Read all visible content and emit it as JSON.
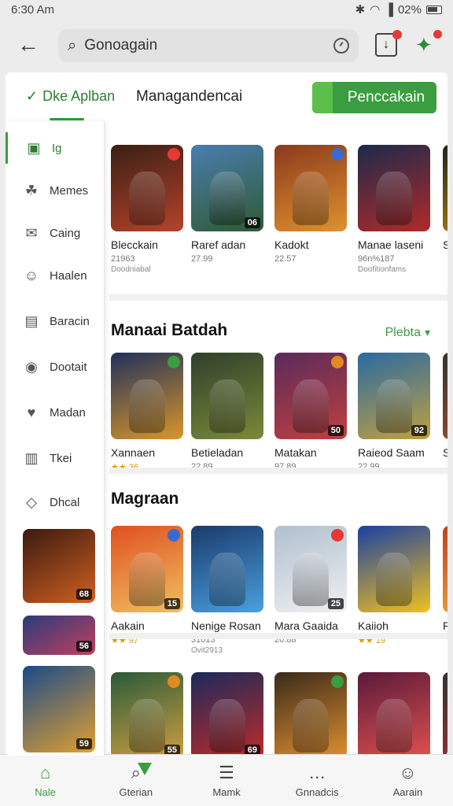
{
  "status": {
    "time": "6:30 Am",
    "battery": "02%"
  },
  "search": {
    "query": "Gonoagain"
  },
  "tabs": {
    "first": "Dke Aplban",
    "second": "Managandencai",
    "cta": "Penccakain"
  },
  "rail": [
    {
      "label": "Ig",
      "icon": "grid-icon",
      "active": true
    },
    {
      "label": "Memes",
      "icon": "leaf-icon"
    },
    {
      "label": "Caing",
      "icon": "mail-icon"
    },
    {
      "label": "Haalen",
      "icon": "person-icon"
    },
    {
      "label": "Baracin",
      "icon": "bag-icon"
    },
    {
      "label": "Dootait",
      "icon": "controller-icon"
    },
    {
      "label": "Madan",
      "icon": "heart-icon"
    },
    {
      "label": "Tkei",
      "icon": "book-icon"
    },
    {
      "label": "Dhcal",
      "icon": "tag-icon"
    }
  ],
  "rail_thumbs": [
    {
      "rating": "68"
    },
    {
      "rating": "56"
    },
    {
      "rating": "59"
    }
  ],
  "sections": [
    {
      "title": "",
      "link": "",
      "cards": [
        {
          "name": "Blecckain",
          "meta": "21963",
          "meta2": "Doodniabal",
          "rating": "",
          "colors": [
            "#3a1f14",
            "#b5432a"
          ]
        },
        {
          "name": "Raref adan",
          "meta": "27.99",
          "meta2": "",
          "rating": "06",
          "colors": [
            "#4a7db0",
            "#2f5a32"
          ]
        },
        {
          "name": "Kadokt",
          "meta": "22.57",
          "meta2": "",
          "rating": "",
          "colors": [
            "#8a3a1c",
            "#e0912f"
          ]
        },
        {
          "name": "Manae laseni",
          "meta": "96n%187",
          "meta2": "Doofitionfams",
          "rating": "",
          "colors": [
            "#1b2a4a",
            "#b02a2a"
          ]
        },
        {
          "name": "Sc",
          "meta": "",
          "meta2": "",
          "rating": "",
          "colors": [
            "#222",
            "#b8860b"
          ]
        }
      ]
    },
    {
      "title": "Manaai  Batdah",
      "link": "Plebta",
      "cards": [
        {
          "name": "Xannaen",
          "meta": "★★ 36",
          "meta2": "",
          "rating": "",
          "colors": [
            "#20305a",
            "#d9962a"
          ]
        },
        {
          "name": "Betieladan",
          "meta": "22.89",
          "meta2": "",
          "rating": "",
          "colors": [
            "#2f3f2a",
            "#7a8a3a"
          ]
        },
        {
          "name": "Matakan",
          "meta": "97.89",
          "meta2": "",
          "rating": "50",
          "colors": [
            "#5a2a5a",
            "#c04040"
          ]
        },
        {
          "name": "Raieod Saam",
          "meta": "22.99",
          "meta2": "",
          "rating": "92",
          "colors": [
            "#2a6aa0",
            "#c0a040"
          ]
        },
        {
          "name": "Sc",
          "meta": "",
          "meta2": "",
          "rating": "",
          "colors": [
            "#333",
            "#a0502a"
          ]
        }
      ]
    },
    {
      "title": "Magraan",
      "link": "",
      "cards": [
        {
          "name": "Aakain",
          "meta": "★★ 97",
          "meta2": "",
          "rating": "15",
          "colors": [
            "#e05020",
            "#f0c060"
          ]
        },
        {
          "name": "Nenige Rosan",
          "meta": "31013",
          "meta2": "Ovit2913",
          "rating": "",
          "colors": [
            "#1a3a6a",
            "#4aa0e0"
          ]
        },
        {
          "name": "Mara Gaaida",
          "meta": "20.88",
          "meta2": "",
          "rating": "25",
          "colors": [
            "#b0c0d0",
            "#f0f0f0"
          ]
        },
        {
          "name": "Kaiioh",
          "meta": "★★ 19",
          "meta2": "",
          "rating": "",
          "colors": [
            "#1a40a0",
            "#f0c020"
          ]
        },
        {
          "name": "Ra",
          "meta": "",
          "meta2": "",
          "rating": "",
          "colors": [
            "#c04020",
            "#f0b040"
          ]
        }
      ]
    },
    {
      "title": "",
      "link": "",
      "cards": [
        {
          "name": "",
          "meta": "",
          "meta2": "",
          "rating": "55",
          "colors": [
            "#2a5a3a",
            "#d0a040"
          ]
        },
        {
          "name": "",
          "meta": "",
          "meta2": "",
          "rating": "69",
          "colors": [
            "#1a2a5a",
            "#c02a2a"
          ]
        },
        {
          "name": "",
          "meta": "",
          "meta2": "",
          "rating": "",
          "colors": [
            "#3a2a1a",
            "#e09030"
          ]
        },
        {
          "name": "",
          "meta": "",
          "meta2": "",
          "rating": "",
          "colors": [
            "#5a1a3a",
            "#e05050"
          ]
        },
        {
          "name": "",
          "meta": "",
          "meta2": "",
          "rating": "",
          "colors": [
            "#333",
            "#a03030"
          ]
        }
      ]
    }
  ],
  "bottom_nav": [
    {
      "label": "Nale",
      "icon": "home-icon",
      "active": true
    },
    {
      "label": "Gterian",
      "icon": "search-icon"
    },
    {
      "label": "Mamk",
      "icon": "list-icon"
    },
    {
      "label": "Gnnadcis",
      "icon": "dots-icon"
    },
    {
      "label": "Aarain",
      "icon": "person-icon"
    }
  ],
  "colors": {
    "accent": "#3a9d3f",
    "tab_text": "#2e7d32",
    "badge_red": "#e53935"
  }
}
